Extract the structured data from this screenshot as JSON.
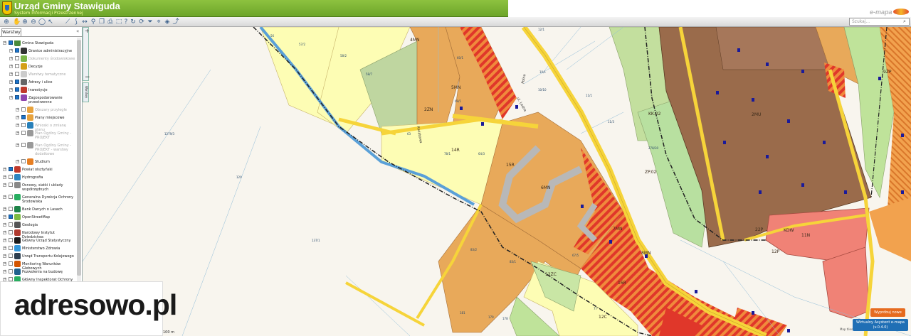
{
  "header": {
    "title": "Urząd Gminy Stawiguda",
    "subtitle": "System Informacji Przestrzennej",
    "brand": "e-mapa"
  },
  "search": {
    "placeholder": "Szukaj..."
  },
  "sidebar": {
    "tab_label": "Warstwy",
    "layers": [
      {
        "label": "Gmina Stawiguda",
        "checked": true,
        "indent": 0,
        "icon": "map-icon",
        "color": "#4a8a3a"
      },
      {
        "label": "Granice administracyjne",
        "checked": true,
        "indent": 1,
        "icon": "border-icon",
        "color": "#333333"
      },
      {
        "label": "Dokumenty środowiskowe",
        "checked": false,
        "indent": 1,
        "icon": "document-icon",
        "color": "#7ab648",
        "dim": true
      },
      {
        "label": "Decyzje",
        "checked": false,
        "indent": 1,
        "icon": "decision-icon",
        "color": "#d4a017"
      },
      {
        "label": "Warstwy tematyczne",
        "checked": false,
        "indent": 1,
        "icon": "theme-icon",
        "color": "#cccccc",
        "dim": true
      },
      {
        "label": "Adresy i ulice",
        "checked": true,
        "indent": 1,
        "icon": "address-icon",
        "color": "#666666"
      },
      {
        "label": "Inwestycje",
        "checked": true,
        "indent": 1,
        "icon": "investment-icon",
        "color": "#c0392b"
      },
      {
        "label": "Zagospodarowanie przestrzenne",
        "checked": true,
        "indent": 1,
        "icon": "planning-icon",
        "color": "#8e44ad"
      },
      {
        "label": "Obszary przyległe",
        "checked": false,
        "indent": 2,
        "icon": "area-icon",
        "color": "#e8a33d",
        "dim": true
      },
      {
        "label": "Plany miejscowe",
        "checked": true,
        "indent": 2,
        "icon": "plan-icon",
        "color": "#e8a33d"
      },
      {
        "label": "Wnioski o zmianę planu",
        "checked": false,
        "indent": 2,
        "icon": "request-icon",
        "color": "#2980b9",
        "dim": true
      },
      {
        "label": "Plan Ogólny Gminy - PROJEKT",
        "checked": false,
        "indent": 2,
        "icon": "project-icon",
        "color": "#999999",
        "dim": true
      },
      {
        "label": "Plan Ogólny Gminy - PROJEKT - warstwy dodatkowe",
        "checked": false,
        "indent": 2,
        "icon": "project-extra-icon",
        "color": "#999999",
        "dim": true
      },
      {
        "label": "Studium",
        "checked": false,
        "indent": 2,
        "icon": "study-icon",
        "color": "#e67e22"
      },
      {
        "label": "Powiat olsztyński",
        "checked": true,
        "indent": 0,
        "icon": "county-icon",
        "color": "#c0392b"
      },
      {
        "label": "Hydrografia",
        "checked": false,
        "indent": 0,
        "icon": "water-icon",
        "color": "#2e86c1"
      },
      {
        "label": "Osnowy, siatki i układy współrzędnych",
        "checked": false,
        "indent": 0,
        "icon": "grid-icon",
        "color": "#888888"
      },
      {
        "label": "Generalna Dyrekcja Ochrony Środowiska",
        "checked": false,
        "indent": 0,
        "icon": "gdos-icon",
        "color": "#27ae60"
      },
      {
        "label": "Bank Danych o Lasach",
        "checked": false,
        "indent": 0,
        "icon": "forest-icon",
        "color": "#1e8449"
      },
      {
        "label": "OpenStreetMap",
        "checked": true,
        "indent": 0,
        "icon": "osm-icon",
        "color": "#7dbb42"
      },
      {
        "label": "Geologia",
        "checked": false,
        "indent": 0,
        "icon": "geology-icon",
        "color": "#555555"
      },
      {
        "label": "Narodowy Instytut Dziedzictwa",
        "checked": false,
        "indent": 0,
        "icon": "heritage-icon",
        "color": "#b03a2e"
      },
      {
        "label": "Główny Urząd Statystyczny",
        "checked": false,
        "indent": 0,
        "icon": "stats-icon",
        "color": "#1a1a1a"
      },
      {
        "label": "Ministerstwo Zdrowia",
        "checked": false,
        "indent": 0,
        "icon": "health-icon",
        "color": "#3498db"
      },
      {
        "label": "Urząd Transportu Kolejowego",
        "checked": false,
        "indent": 0,
        "icon": "rail-icon",
        "color": "#2c3e50"
      },
      {
        "label": "Monitoring Warunków Glebowych",
        "checked": false,
        "indent": 0,
        "icon": "soil-icon",
        "color": "#d35400"
      },
      {
        "label": "Pozwolenia na budowę",
        "checked": false,
        "indent": 0,
        "icon": "permit-icon",
        "color": "#1f618d"
      },
      {
        "label": "Główny Inspektorat Ochrony Środowiska",
        "checked": false,
        "indent": 0,
        "icon": "gios-icon",
        "color": "#27ae60"
      },
      {
        "label": "Audyt Krajobrazowy Województwa",
        "checked": false,
        "indent": 0,
        "icon": "landscape-icon",
        "color": "#cd6155"
      }
    ]
  },
  "map": {
    "side_tab": "Warstwy",
    "zone_labels": [
      "14R",
      "15R",
      "16R",
      "2ZN",
      "5MN",
      "4MN",
      "6MN",
      "7MN",
      "8MN",
      "12C",
      "12ZC",
      "11N",
      "12P",
      "22P",
      "ZP.02",
      "KK.02",
      "KDW",
      "9ZP",
      "2MU"
    ],
    "parcel_labels": [
      "56",
      "57/2",
      "58/2",
      "58/7",
      "63",
      "64/3",
      "60/1",
      "69/1",
      "78/1",
      "67/5",
      "12/1",
      "10/1",
      "10/10",
      "11/3",
      "11/1",
      "278/30",
      "1279/3",
      "120",
      "137/1",
      "83/2",
      "83/1",
      "77",
      "181",
      "179",
      "178"
    ],
    "street_labels": [
      "ul. Leśna",
      "Kwiatowa",
      "Polna"
    ],
    "scale_label": "100 m",
    "attribution": "Map tiles ...",
    "report_button": "Wypróbuj nowe",
    "assistant_button": "Wirtualny Asystent e-mapa",
    "assistant_version": "(v.0.4.0)"
  },
  "logo": {
    "text": "adresowo.pl"
  },
  "colors": {
    "header_green": "#7cb434",
    "residential": "#e8a95a",
    "agricultural": "#fdfdb4",
    "services": "#f08276",
    "park": "#b8e0a0",
    "road_yellow": "#f6d43a",
    "water_blue": "#5aa0d8"
  }
}
